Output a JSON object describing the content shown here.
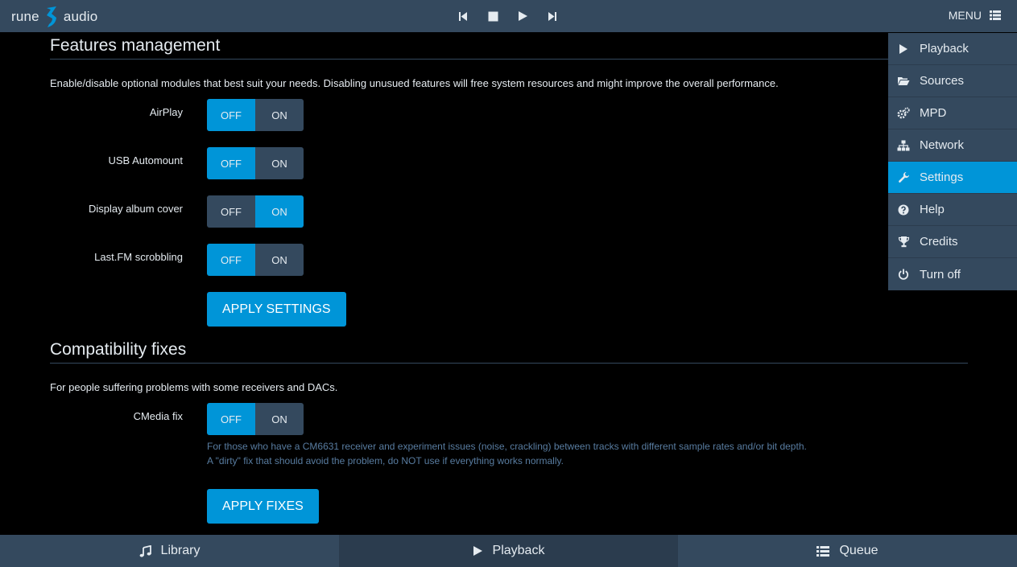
{
  "header": {
    "logo_left": "rune",
    "logo_right": "audio",
    "menu_label": "MENU",
    "transport": [
      "previous-icon",
      "stop-icon",
      "play-icon",
      "next-icon"
    ]
  },
  "features": {
    "title": "Features management",
    "description": "Enable/disable optional modules that best suit your needs. Disabling unusued features will free system resources and might improve the overall performance.",
    "rows": [
      {
        "label": "AirPlay",
        "off": "OFF",
        "on": "ON",
        "state": "off"
      },
      {
        "label": "USB Automount",
        "off": "OFF",
        "on": "ON",
        "state": "off"
      },
      {
        "label": "Display album cover",
        "off": "OFF",
        "on": "ON",
        "state": "on"
      },
      {
        "label": "Last.FM scrobbling",
        "off": "OFF",
        "on": "ON",
        "state": "off"
      }
    ],
    "apply_label": "APPLY SETTINGS"
  },
  "compat": {
    "title": "Compatibility fixes",
    "description": "For people suffering problems with some receivers and DACs.",
    "rows": [
      {
        "label": "CMedia fix",
        "off": "OFF",
        "on": "ON",
        "state": "off"
      }
    ],
    "help_line1": "For those who have a CM6631 receiver and experiment issues (noise, crackling) between tracks with different sample rates and/or bit depth.",
    "help_line2": "A \"dirty\" fix that should avoid the problem, do NOT use if everything works normally.",
    "apply_label": "APPLY FIXES"
  },
  "side_menu": {
    "items": [
      {
        "label": "Playback",
        "icon": "play-icon"
      },
      {
        "label": "Sources",
        "icon": "folder-open-icon"
      },
      {
        "label": "MPD",
        "icon": "gears-icon"
      },
      {
        "label": "Network",
        "icon": "sitemap-icon"
      },
      {
        "label": "Settings",
        "icon": "wrench-icon",
        "active": true
      },
      {
        "label": "Help",
        "icon": "question-circle-icon"
      },
      {
        "label": "Credits",
        "icon": "trophy-icon"
      },
      {
        "label": "Turn off",
        "icon": "power-icon"
      }
    ]
  },
  "bottom_tabs": [
    {
      "label": "Library",
      "icon": "music-icon"
    },
    {
      "label": "Playback",
      "icon": "play-icon",
      "active": true
    },
    {
      "label": "Queue",
      "icon": "list-icon"
    }
  ],
  "colors": {
    "accent": "#0095d8",
    "bar": "#34495e",
    "bar_dark": "#2b3c4e",
    "background": "#000000",
    "help_text": "#587ca0"
  }
}
